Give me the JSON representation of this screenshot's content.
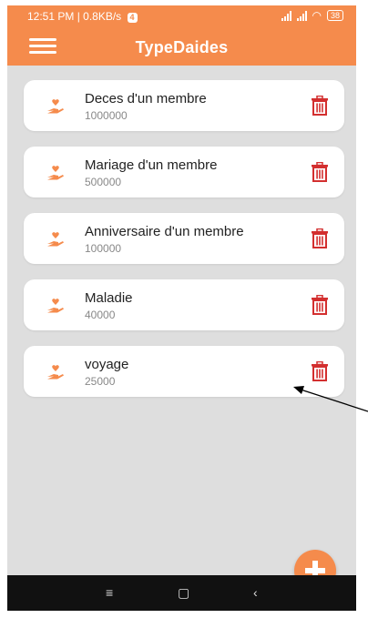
{
  "statusbar": {
    "time": "12:51 PM | 0.8KB/s",
    "badge": "4",
    "battery": "38"
  },
  "header": {
    "title": "TypeDaides"
  },
  "items": [
    {
      "title": "Deces d'un membre",
      "value": "1000000"
    },
    {
      "title": "Mariage d'un membre",
      "value": "500000"
    },
    {
      "title": "Anniversaire d'un membre",
      "value": "100000"
    },
    {
      "title": "Maladie",
      "value": "40000"
    },
    {
      "title": "voyage",
      "value": "25000"
    }
  ],
  "colors": {
    "accent": "#f58b4c",
    "delete": "#d32f2f",
    "background": "#dedede"
  },
  "icons": {
    "item_icon": "hand-heart-icon",
    "delete_icon": "trash-icon",
    "menu_icon": "hamburger-menu-icon",
    "fab_icon": "plus-icon"
  }
}
